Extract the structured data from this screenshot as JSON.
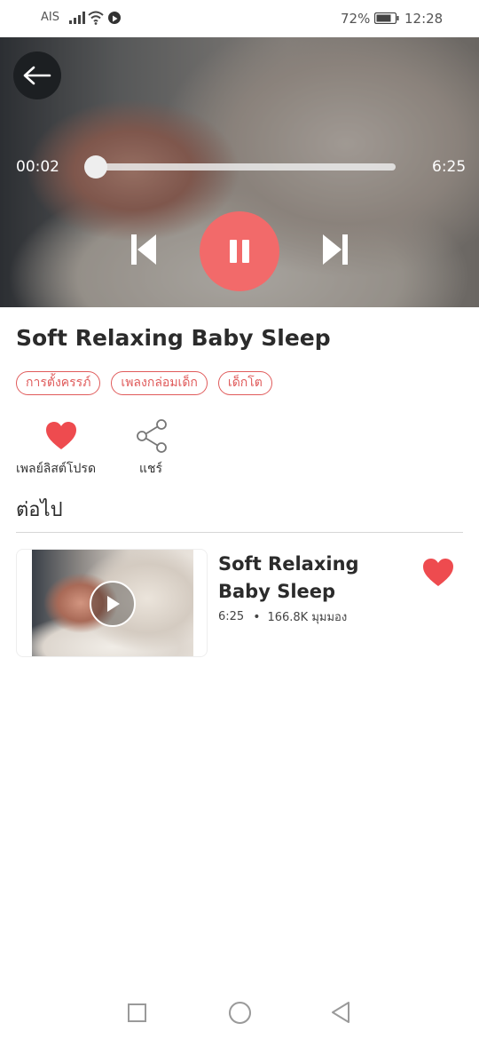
{
  "status_bar": {
    "carrier": "AIS",
    "battery_percent": "72%",
    "time": "12:28"
  },
  "player": {
    "current_time": "00:02",
    "total_time": "6:25",
    "progress": 0.005,
    "state": "playing"
  },
  "song": {
    "title": "Soft Relaxing Baby Sleep",
    "tags": [
      "การตั้งครรภ์",
      "เพลงกล่อมเด็ก",
      "เด็กโต"
    ]
  },
  "actions": {
    "favorite_label": "เพลย์ลิสต์โปรด",
    "share_label": "แชร์"
  },
  "up_next": {
    "heading": "ต่อไป",
    "items": [
      {
        "title": "Soft Relaxing Baby Sleep",
        "duration": "6:25",
        "views": "166.8K มุมมอง"
      }
    ]
  },
  "colors": {
    "accent": "#f26a6a",
    "tag": "#e05b5b",
    "heart": "#ee4b4f"
  },
  "icons": {
    "back": "arrow-left-icon",
    "prev": "skip-previous-icon",
    "pause": "pause-icon",
    "next": "skip-next-icon",
    "favorite": "heart-icon",
    "share": "share-icon",
    "play": "play-icon"
  }
}
